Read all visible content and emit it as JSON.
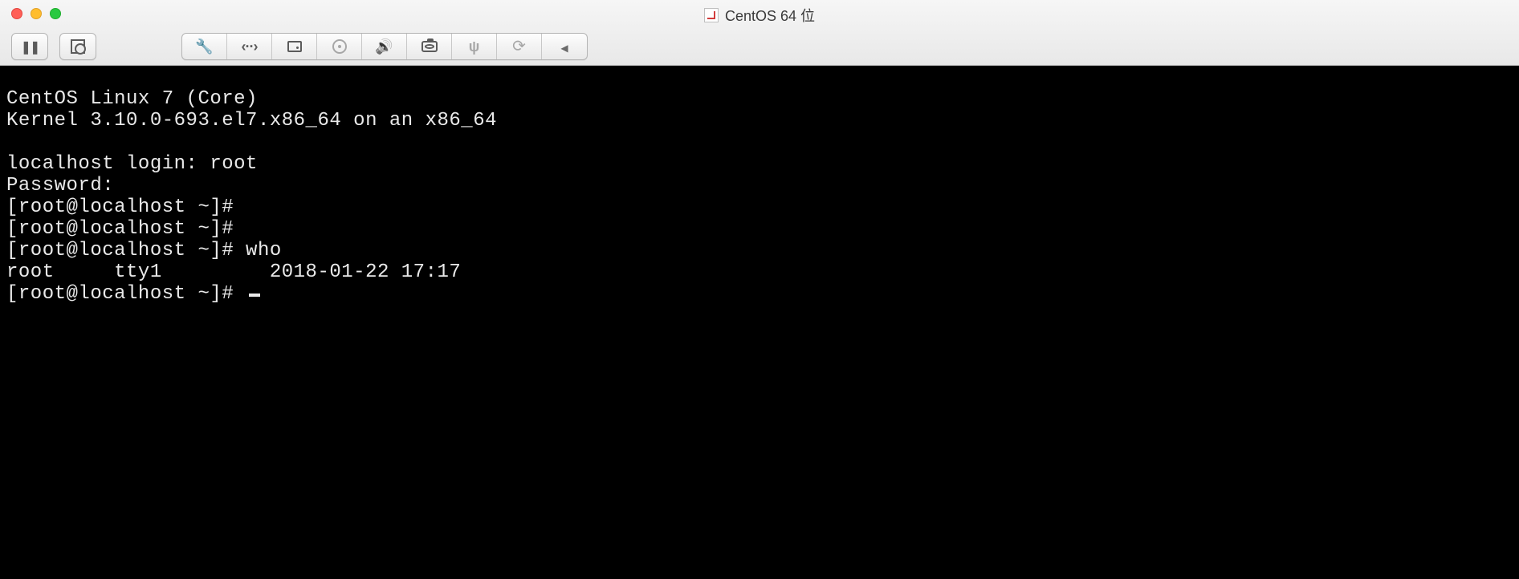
{
  "window": {
    "title": "CentOS 64 位"
  },
  "toolbar": {
    "pause": "pause",
    "snapshot": "snapshot",
    "settings": "settings",
    "network": "network",
    "harddisk": "harddisk",
    "optical": "optical",
    "sound": "sound",
    "camera": "camera",
    "usb": "usb",
    "refresh": "refresh",
    "back": "back"
  },
  "terminal": {
    "lines": [
      "CentOS Linux 7 (Core)",
      "Kernel 3.10.0-693.el7.x86_64 on an x86_64",
      "",
      "localhost login: root",
      "Password:",
      "[root@localhost ~]#",
      "[root@localhost ~]#",
      "[root@localhost ~]# who",
      "root     tty1         2018-01-22 17:17",
      "[root@localhost ~]# "
    ]
  }
}
